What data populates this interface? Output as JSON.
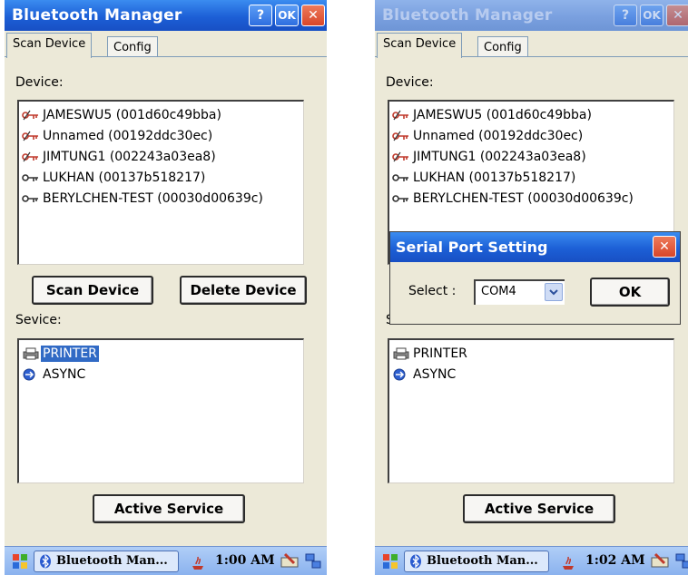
{
  "left_screen": {
    "window": {
      "title": "Bluetooth Manager",
      "help_label": "?",
      "ok_label": "OK",
      "close_label": "✕"
    },
    "tabs": [
      {
        "label": "Scan Device"
      },
      {
        "label": "Config"
      }
    ],
    "device_label": "Device:",
    "devices": [
      {
        "label": "JAMESWU5 (001d60c49bba)",
        "icon": "broken-link-icon"
      },
      {
        "label": "Unnamed (00192ddc30ec)",
        "icon": "broken-link-icon"
      },
      {
        "label": "JIMTUNG1 (002243a03ea8)",
        "icon": "broken-link-icon"
      },
      {
        "label": "LUKHAN (00137b518217)",
        "icon": "key-icon"
      },
      {
        "label": "BERYLCHEN-TEST (00030d00639c)",
        "icon": "key-icon"
      }
    ],
    "scan_button": "Scan Device",
    "delete_button": "Delete Device",
    "service_label": "Sevice:",
    "services": [
      {
        "label": "PRINTER",
        "icon": "printer-icon",
        "selected": true
      },
      {
        "label": "ASYNC",
        "icon": "async-icon",
        "selected": false
      }
    ],
    "active_service_button": "Active Service",
    "taskbar": {
      "task_label": "Bluetooth Man...",
      "clock": "1:00 AM"
    }
  },
  "right_screen": {
    "window": {
      "title": "Bluetooth Manager",
      "help_label": "?",
      "ok_label": "OK",
      "close_label": "✕"
    },
    "tabs": [
      {
        "label": "Scan Device"
      },
      {
        "label": "Config"
      }
    ],
    "device_label": "Device:",
    "devices": [
      {
        "label": "JAMESWU5 (001d60c49bba)",
        "icon": "broken-link-icon"
      },
      {
        "label": "Unnamed (00192ddc30ec)",
        "icon": "broken-link-icon"
      },
      {
        "label": "JIMTUNG1 (002243a03ea8)",
        "icon": "broken-link-icon"
      },
      {
        "label": "LUKHAN (00137b518217)",
        "icon": "key-icon"
      },
      {
        "label": "BERYLCHEN-TEST (00030d00639c)",
        "icon": "key-icon"
      }
    ],
    "service_label": "Sevice:",
    "services": [
      {
        "label": "PRINTER",
        "icon": "printer-icon",
        "selected": false
      },
      {
        "label": "ASYNC",
        "icon": "async-icon",
        "selected": false
      }
    ],
    "active_service_button": "Active Service",
    "dialog": {
      "title": "Serial Port Setting",
      "close_label": "✕",
      "select_label": "Select :",
      "select_value": "COM4",
      "ok_button": "OK"
    },
    "taskbar": {
      "task_label": "Bluetooth Man...",
      "clock": "1:02 AM"
    }
  },
  "colors": {
    "titlebar": "#1c5fd6",
    "selection": "#316ac5",
    "close": "#d8462a",
    "window_bg": "#ece9d8"
  }
}
